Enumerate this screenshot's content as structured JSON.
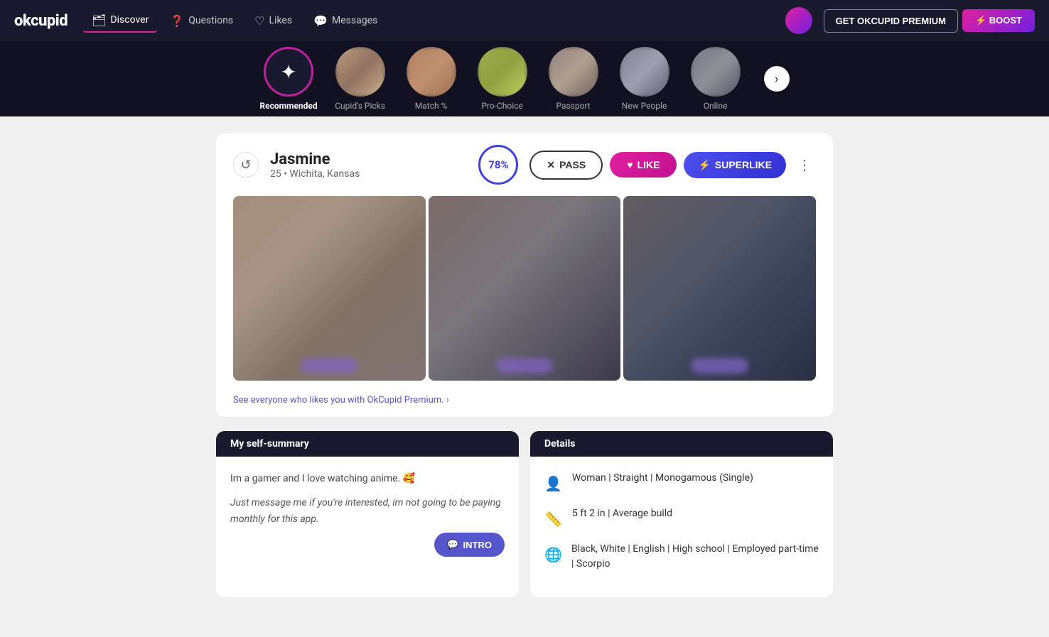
{
  "logo": "okcupid",
  "nav": {
    "items": [
      {
        "label": "Discover",
        "icon": "🗂",
        "active": true
      },
      {
        "label": "Questions",
        "icon": "❓",
        "active": false
      },
      {
        "label": "Likes",
        "icon": "♡",
        "active": false
      },
      {
        "label": "Messages",
        "icon": "💬",
        "active": false
      }
    ],
    "premium_btn": "GET OKCUPID PREMIUM",
    "boost_btn": "⚡ BOOST"
  },
  "categories": [
    {
      "label": "Recommended",
      "type": "recommended",
      "active": true
    },
    {
      "label": "Cupid's Picks",
      "type": "thumb",
      "active": false
    },
    {
      "label": "Match %",
      "type": "thumb",
      "active": false
    },
    {
      "label": "Pro-Choice",
      "type": "thumb",
      "active": false
    },
    {
      "label": "Passport",
      "type": "thumb",
      "active": false
    },
    {
      "label": "New People",
      "type": "thumb",
      "active": false
    },
    {
      "label": "Online",
      "type": "thumb",
      "active": false
    }
  ],
  "profile": {
    "name": "Jasmine",
    "age": "25",
    "location": "Wichita, Kansas",
    "match_pct": "78%",
    "pass_label": "PASS",
    "like_label": "LIKE",
    "superlike_label": "SUPERLIKE",
    "premium_cta": "See everyone who likes you with OkCupid Premium. ›"
  },
  "self_summary": {
    "header": "My self-summary",
    "text1": "Im a gamer and I love watching anime. 🥰",
    "text2": "Just message me if you're interested, im not going to be paying monthly for this app.",
    "intro_label": "INTRO"
  },
  "details": {
    "header": "Details",
    "rows": [
      {
        "icon": "👤",
        "text": "Woman | Straight | Monogamous (Single)"
      },
      {
        "icon": "📏",
        "text": "5 ft 2 in | Average build"
      },
      {
        "icon": "🌐",
        "text": "Black, White | English | High school | Employed part-time | Scorpio"
      }
    ]
  }
}
